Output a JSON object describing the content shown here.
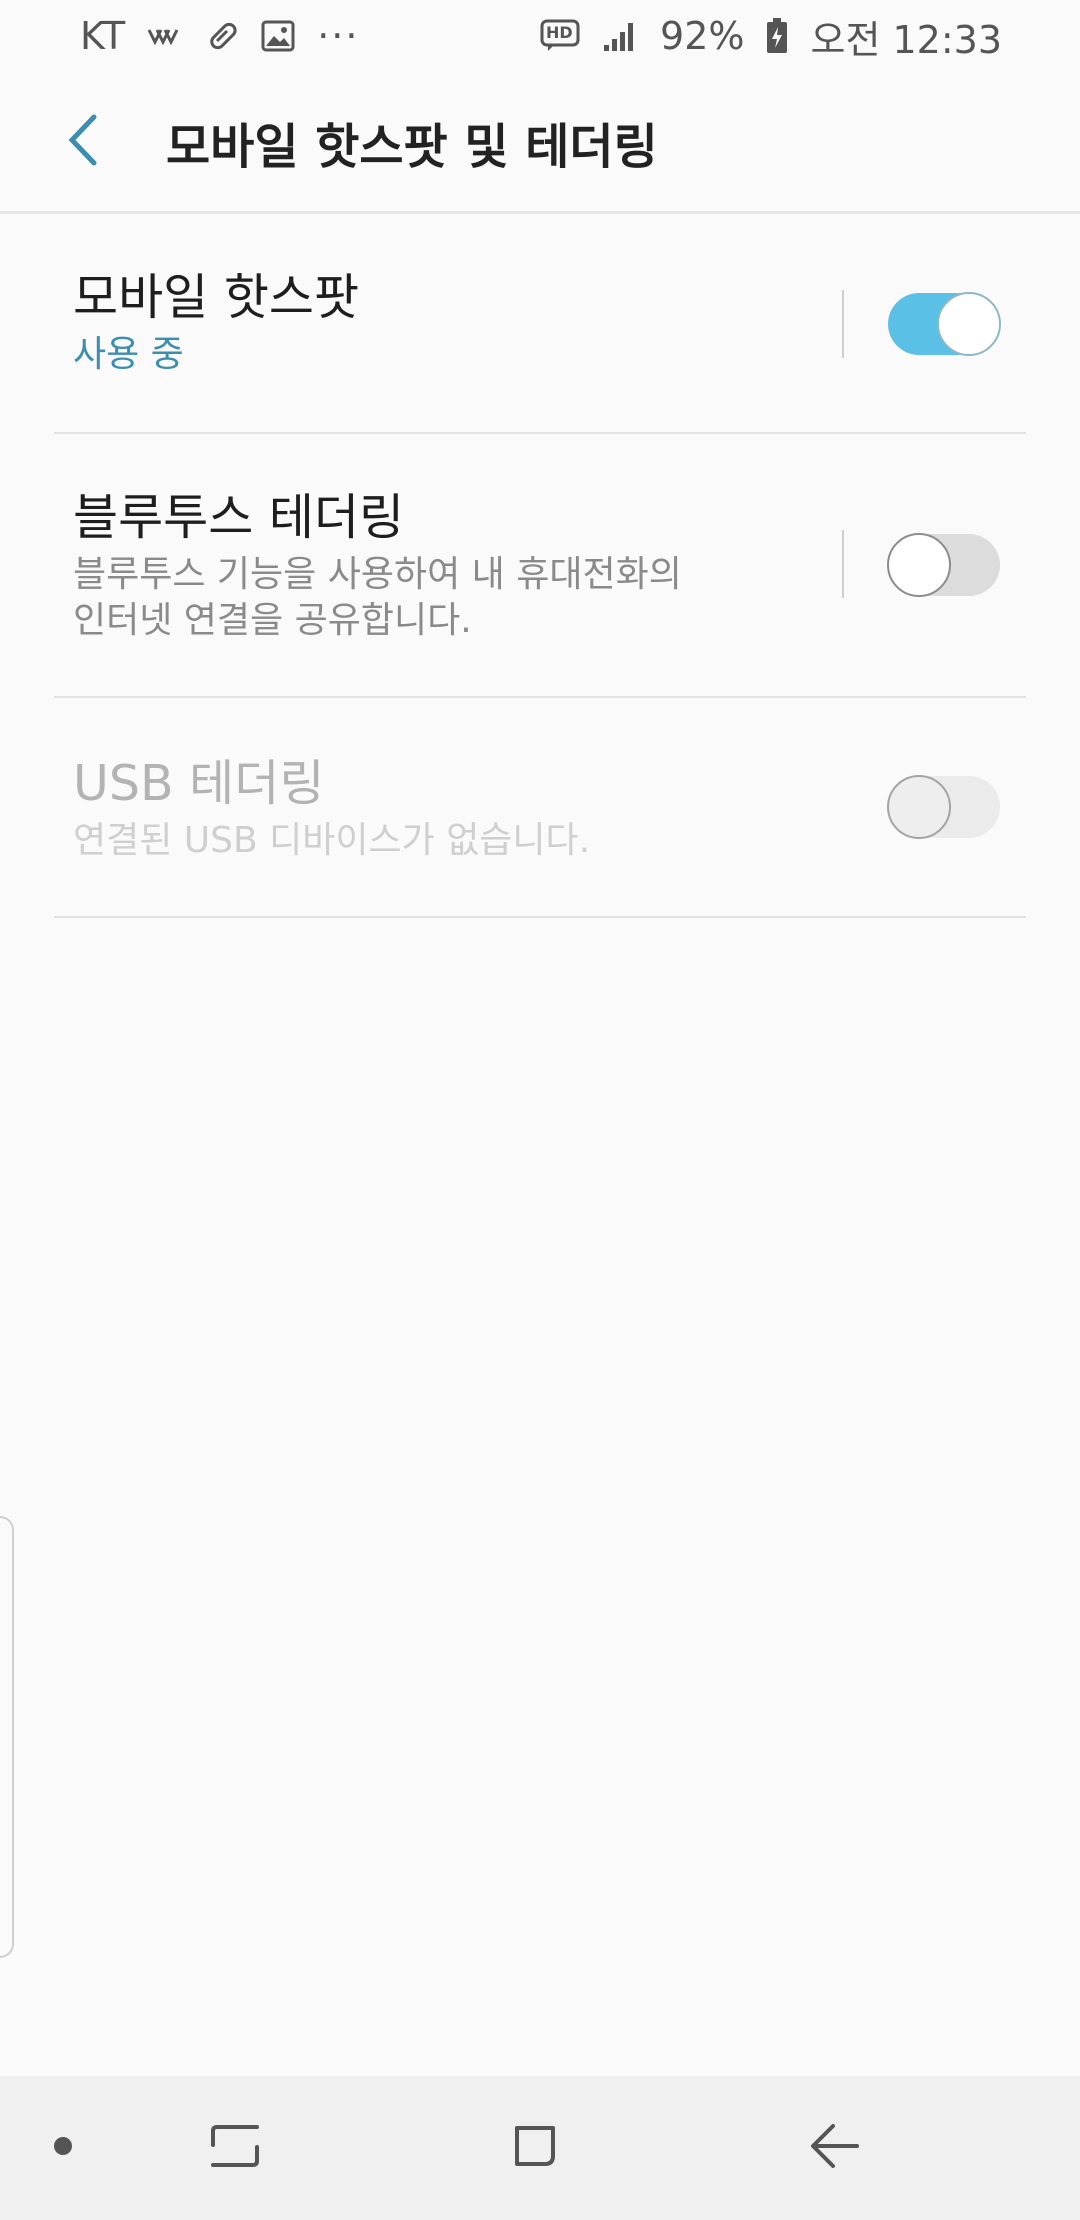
{
  "status_bar": {
    "carrier": "KT",
    "more": "···",
    "hd_badge": "HD",
    "battery": "92%",
    "time": "오전 12:33",
    "icons": [
      "wifi-calling-icon",
      "pill-icon",
      "image-icon",
      "hd-voice-icon",
      "signal-icon",
      "battery-charging-icon"
    ]
  },
  "app_bar": {
    "title": "모바일 핫스팟 및 테더링",
    "back_icon": "chevron-left-icon"
  },
  "settings": [
    {
      "title": "모바일 핫스팟",
      "subtitle": "사용 중",
      "enabled": true,
      "on": true
    },
    {
      "title": "블루투스 테더링",
      "subtitle_line1": "블루투스 기능을 사용하여 내 휴대전화의",
      "subtitle_line2": "인터넷 연결을 공유합니다.",
      "enabled": true,
      "on": false
    },
    {
      "title": "USB 테더링",
      "subtitle": "연결된 USB 디바이스가 없습니다.",
      "enabled": false,
      "on": false
    }
  ],
  "colors": {
    "accent": "#3b8eb0",
    "toggle_on": "#5bc0e6",
    "background": "#fafafa"
  },
  "nav_bar": {
    "icons": [
      "dot-icon",
      "recents-icon",
      "home-icon",
      "back-icon"
    ]
  }
}
